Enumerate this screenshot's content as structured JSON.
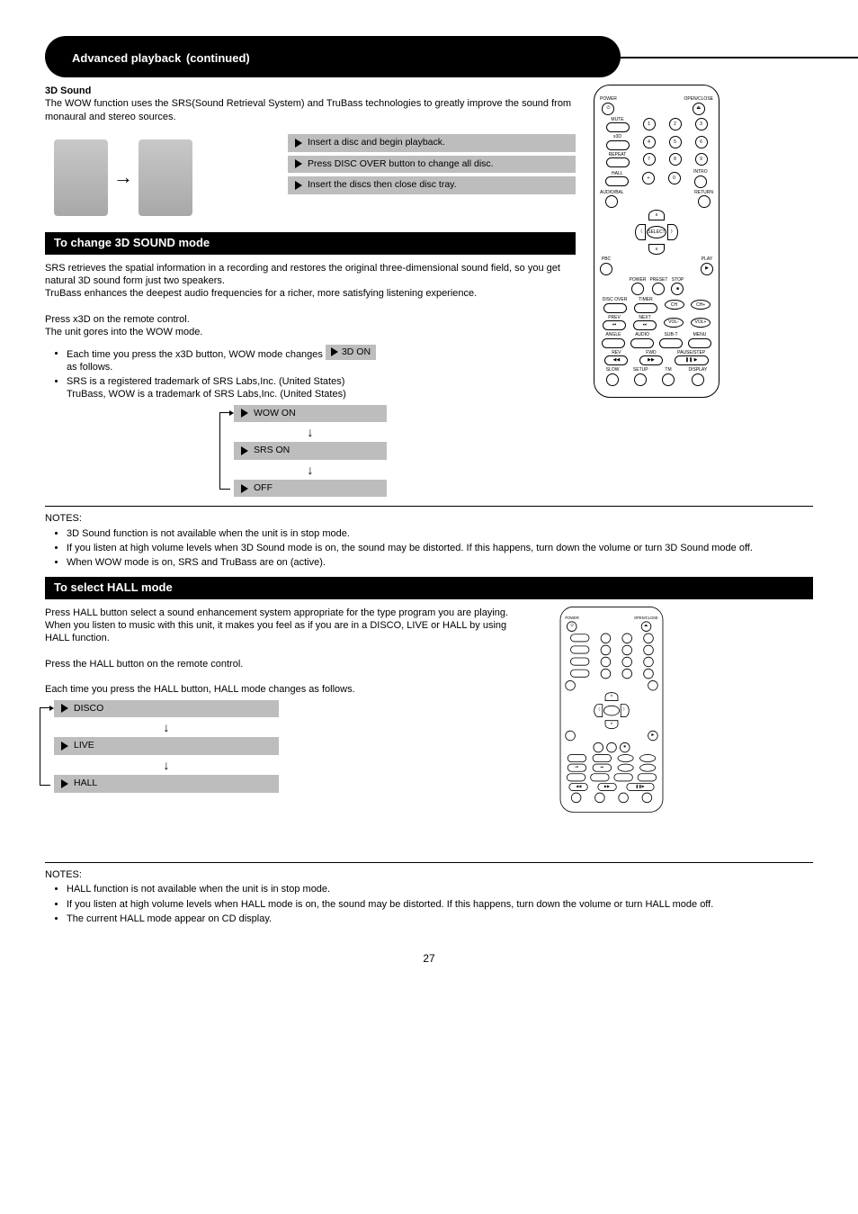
{
  "pageTitle": {
    "main": "Advanced playback",
    "sub": "(continued)"
  },
  "intro": {
    "heading": "3D Sound",
    "body": "The WOW function uses the SRS(Sound Retrieval System) and TruBass technologies to greatly improve the sound from monaural and stereo sources.",
    "srs": "SRS  retrieves the spatial information in a recording and restores the original three-dimensional sound field, so you get natural 3D sound form just two speakers.",
    "trubass": "TruBass enhances the deepest audio frequencies for a richer, more satisfying listening experience."
  },
  "steps": {
    "s1": "Insert a disc and begin playback.",
    "s2": "Press DISC OVER button to change all disc.",
    "s3": "Insert the discs then close disc tray."
  },
  "section1": {
    "title": "To change 3D SOUND mode",
    "lead": "Press x3D on the remote control.",
    "sub": "The unit gores into the WOW mode.",
    "bullet1a": "Each time you press the x3D button, WOW mode changes  ",
    "bullet1b": "as follows.",
    "inlineStep": "3D ON",
    "bullet2a": "SRS is a registered trademark of SRS Labs,Inc. (United States)",
    "bullet2b": "TruBass, WOW is a trademark of SRS Labs,Inc. (United States)",
    "cycle": [
      "WOW ON",
      "SRS ON",
      "OFF"
    ]
  },
  "notes1": {
    "heading": "NOTES:",
    "n1": "3D Sound function is not available when the unit is in stop mode.",
    "n2": "If you listen at high volume levels when 3D Sound mode is on, the sound may be distorted. If this happens, turn down the volume or turn 3D Sound mode off.",
    "n3": "When WOW mode is on, SRS and TruBass are on (active)."
  },
  "section2": {
    "title": "To select HALL mode",
    "body1": "Press HALL button select a sound enhancement system appropriate for the type program you are playing.",
    "body2": "When you listen to music with this unit, it makes you feel as if you are in a DISCO, LIVE or HALL by using HALL function.",
    "body3": "Press the HALL button on the remote control.",
    "body4": "Each time you press the HALL button, HALL mode changes as follows.",
    "cycle": [
      "DISCO",
      "LIVE",
      "HALL"
    ]
  },
  "notes2": {
    "heading": "NOTES:",
    "n1": "HALL function is not available when the unit is in stop mode.",
    "n2": "If you listen at high volume levels when HALL mode is on, the sound may be distorted. If this happens, turn down the volume or turn HALL mode off.",
    "n3": "The current HALL mode appear on CD display."
  },
  "remote": {
    "power": "POWER",
    "openclose": "OPEN/CLOSE",
    "mute": "MUTE",
    "x3d": "x3D",
    "repeat": "REPEAT",
    "hall": "HALL",
    "intro": "INTRO",
    "audioeba": "AUDIO/BAL",
    "return": "RETURN",
    "select": "SELECT",
    "pbc": "PBC",
    "play": "PLAY",
    "stop": "STOP",
    "power2": "POWER",
    "preset": "PRESET",
    "discover": "DISC OVER",
    "timer": "TIMER",
    "ch": "CH",
    "chplus": "CH+",
    "prev": "PREV",
    "next": "NEXT",
    "volm": "VOL-",
    "volp": "VOL+",
    "angle": "ANGLE",
    "audio": "AUDIO",
    "subt": "SUB-T",
    "menu": "MENU",
    "rev": "REV",
    "fwd": "FWD",
    "pausestep": "PAUSE/STEP",
    "slow": "SLOW",
    "setup": "SETUP",
    "tm": "TM",
    "display": "DISPLAY"
  },
  "pageNum": "27"
}
